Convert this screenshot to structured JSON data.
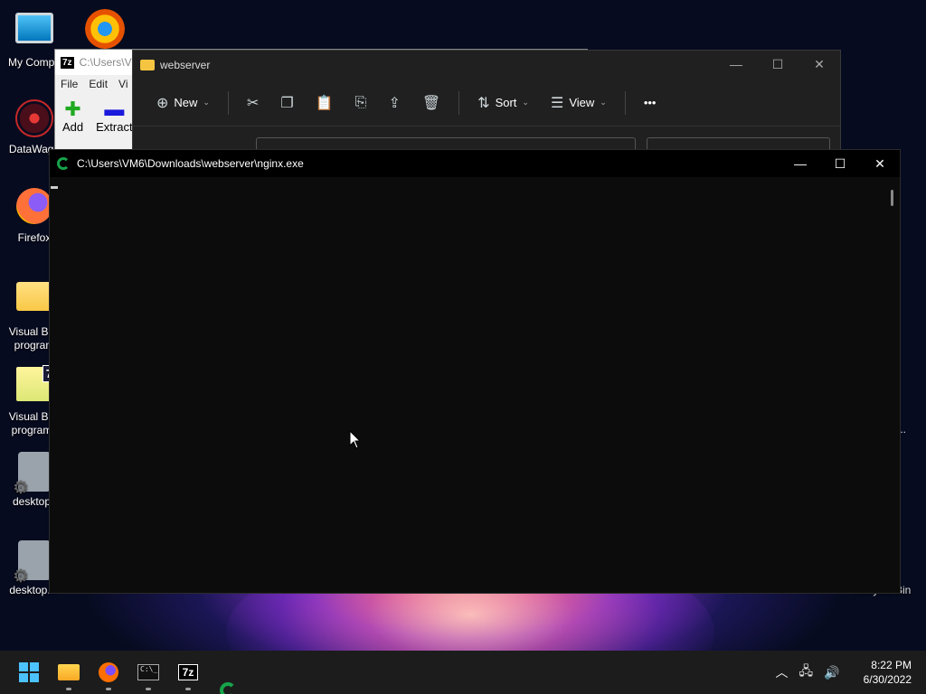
{
  "desktop": {
    "icons": [
      {
        "label": "My Compu"
      },
      {
        "label": "DataWago"
      },
      {
        "label": "Firefox"
      },
      {
        "label": "Visual Bas program"
      },
      {
        "label": "Visual Bas programs"
      },
      {
        "label": "desktop.i"
      },
      {
        "label": "desktop...."
      }
    ],
    "recycle_bin_partial": "Recycle Bin",
    "right_partial_1": "t",
    "right_partial_2": "..."
  },
  "sevenzip_window": {
    "title": "C:\\Users\\V",
    "logo": "7z",
    "menu": [
      "File",
      "Edit",
      "Vi"
    ],
    "add_label": "Add",
    "extract_label": "Extract"
  },
  "explorer_window": {
    "title": "webserver",
    "toolbar": {
      "new_label": "New",
      "sort_label": "Sort",
      "view_label": "View",
      "more_label": "•••"
    }
  },
  "console_window": {
    "title": "C:\\Users\\VM6\\Downloads\\webserver\\nginx.exe"
  },
  "taskbar": {
    "time": "8:22 PM",
    "date": "6/30/2022",
    "seven_zip_label": "7z"
  },
  "colors": {
    "accent": "#4cc2ff",
    "nginx_green": "#16a34a",
    "console_bg": "#0c0c0c",
    "explorer_bg": "#202020"
  }
}
